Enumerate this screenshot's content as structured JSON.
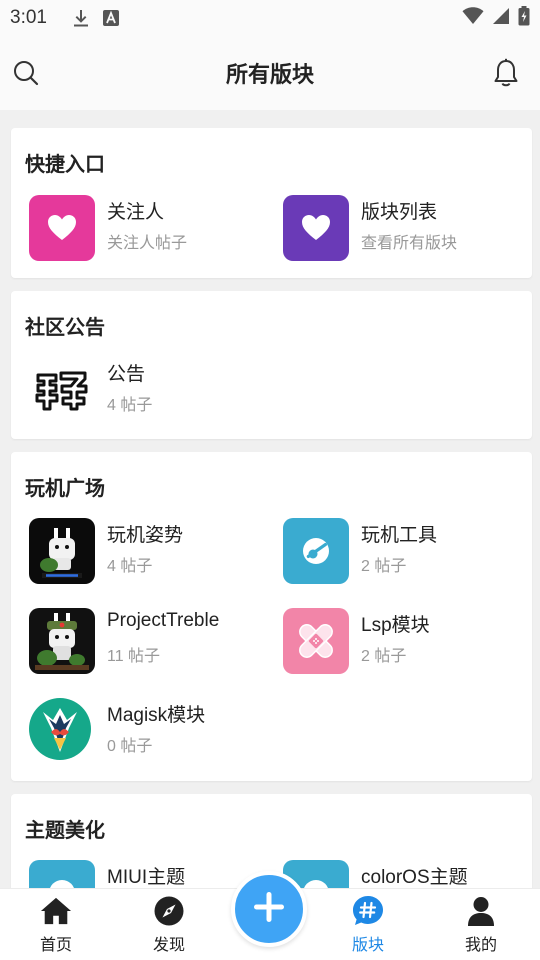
{
  "status_bar": {
    "time": "3:01"
  },
  "app_bar": {
    "title": "所有版块"
  },
  "sections": {
    "quick": {
      "title": "快捷入口",
      "items": [
        {
          "name": "关注人",
          "sub": "关注人帖子",
          "icon": "heart-icon",
          "color": "#e5399b"
        },
        {
          "name": "版块列表",
          "sub": "查看所有版块",
          "icon": "heart-icon",
          "color": "#6a3ab7"
        }
      ]
    },
    "notice": {
      "title": "社区公告",
      "items": [
        {
          "name": "公告",
          "sub": "4 帖子",
          "icon": "qing-character-logo"
        }
      ]
    },
    "play": {
      "title": "玩机广场",
      "items": [
        {
          "name": "玩机姿势",
          "sub": "4 帖子",
          "icon": "fastboot-mascot-icon"
        },
        {
          "name": "玩机工具",
          "sub": "2 帖子",
          "icon": "tool-icon",
          "color": "#3aabd0"
        },
        {
          "name": "ProjectTreble",
          "sub": "11 帖子",
          "icon": "mascot-soldier-icon"
        },
        {
          "name": "Lsp模块",
          "sub": "2 帖子",
          "icon": "bandage-icon",
          "color": "#f285a8"
        },
        {
          "name": "Magisk模块",
          "sub": "0 帖子",
          "icon": "magisk-icon",
          "color": "#15a88a"
        }
      ]
    },
    "theme": {
      "title": "主题美化",
      "items": [
        {
          "name": "MIUI主题",
          "icon": "theme-icon",
          "color": "#3aabd0"
        },
        {
          "name": "colorOS主题",
          "icon": "theme-icon",
          "color": "#3aabd0"
        }
      ]
    }
  },
  "bottom_nav": {
    "items": [
      {
        "label": "首页",
        "icon": "home-icon"
      },
      {
        "label": "发现",
        "icon": "compass-icon"
      },
      {
        "label": "版块",
        "icon": "hashtag-icon",
        "active": true
      },
      {
        "label": "我的",
        "icon": "person-icon"
      }
    ],
    "fab_icon": "plus-icon",
    "accent": "#1e88e5"
  }
}
